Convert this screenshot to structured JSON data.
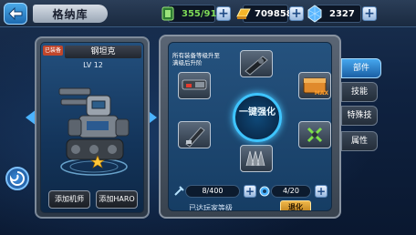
{
  "topbar": {
    "title": "格纳库",
    "resources": [
      {
        "name": "energy",
        "value": "355/91",
        "color": "#7ed957"
      },
      {
        "name": "gold",
        "value": "709858",
        "color": "#ffd24a"
      },
      {
        "name": "crystal",
        "value": "2327",
        "color": "#ffffff"
      }
    ],
    "plus_label": "+"
  },
  "mech": {
    "owned_badge": "已装备",
    "name": "钢坦克",
    "level": "LV 12",
    "add_pilot": "添加机师",
    "add_haro": "添加HARO"
  },
  "upgrade": {
    "hint": "所有装备等级升至满级后升阶",
    "center_label": "一键强化",
    "max_tag": "MAX",
    "count1": "8/400",
    "count2": "4/20",
    "status": "已达玩家等级",
    "degrade": "退化"
  },
  "tabs": [
    "部件",
    "技能",
    "特殊技",
    "属性"
  ],
  "colors": {
    "accent": "#3ec4ff",
    "tab_active": "#2a86d6",
    "degrade": "#e0a030"
  }
}
